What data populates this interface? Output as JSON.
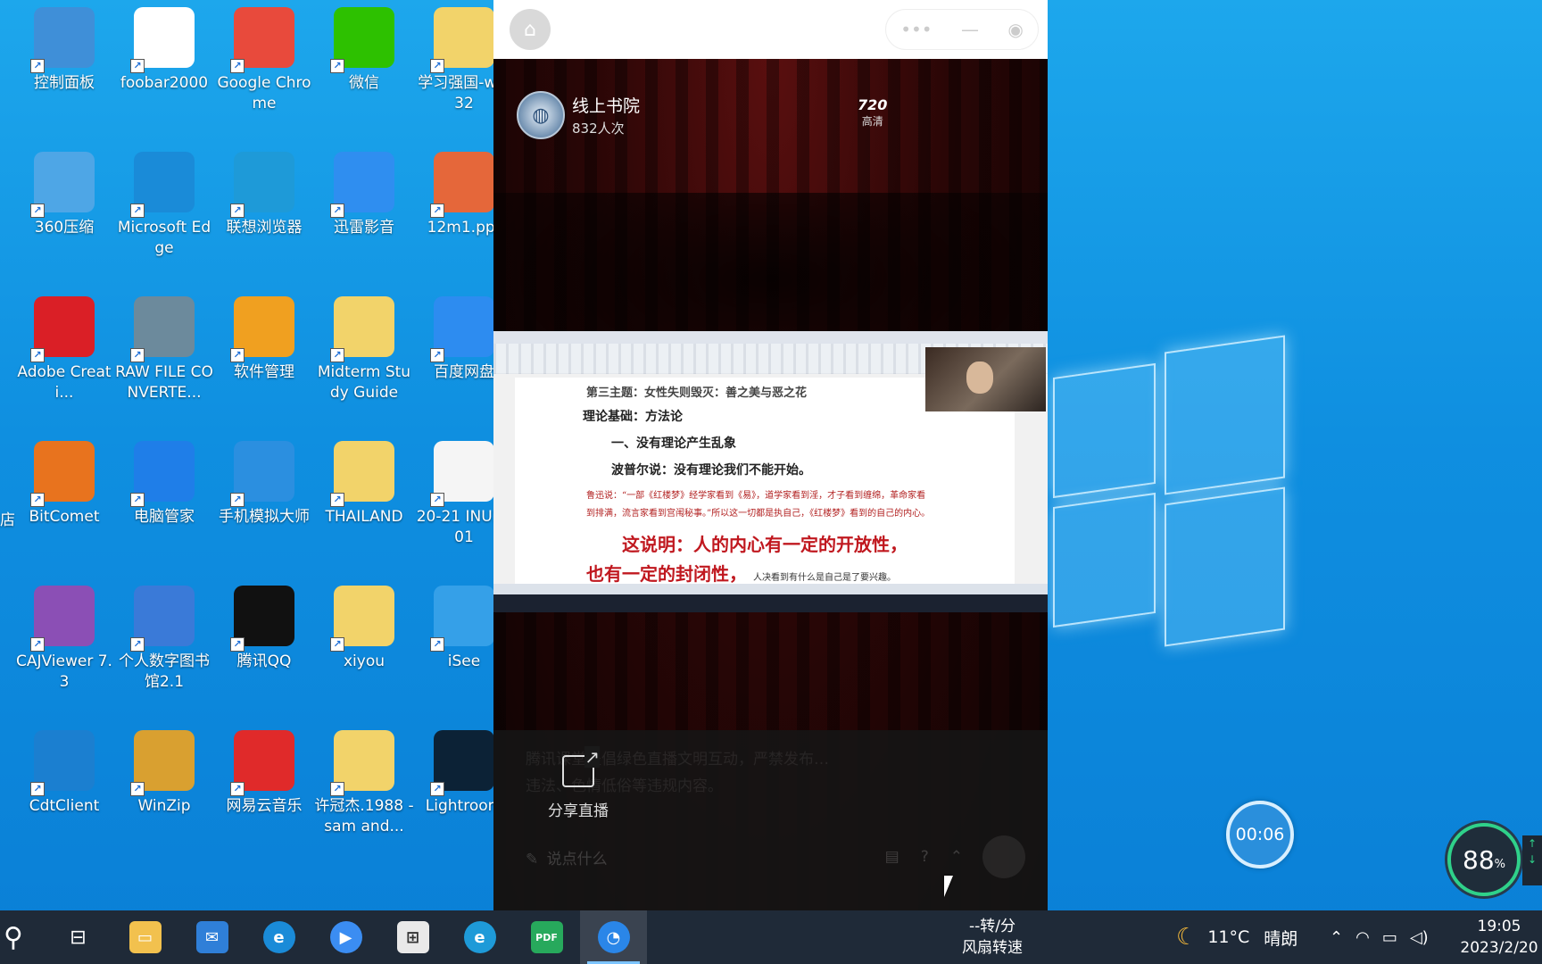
{
  "desktop_icons": [
    {
      "label": "控制面板",
      "icon": "control-panel-icon",
      "color": "#3f8fd8"
    },
    {
      "label": "foobar2000",
      "icon": "foobar-icon",
      "color": "#ffffff"
    },
    {
      "label": "Google Chrome",
      "icon": "chrome-icon",
      "color": "#e84a3c"
    },
    {
      "label": "微信",
      "icon": "wechat-icon",
      "color": "#2dc100"
    },
    {
      "label": "学习强国-win32",
      "icon": "folder-icon",
      "color": "#f2d36a"
    },
    {
      "label": "360压缩",
      "icon": "zip-360-icon",
      "color": "#4ea6e6"
    },
    {
      "label": "Microsoft Edge",
      "icon": "edge-icon",
      "color": "#1a8bd8"
    },
    {
      "label": "联想浏览器",
      "icon": "lenovo-browser-icon",
      "color": "#1e9ad8"
    },
    {
      "label": "迅雷影音",
      "icon": "xunlei-player-icon",
      "color": "#2f8ef0"
    },
    {
      "label": "12m1.ppt",
      "icon": "ppt-file-icon",
      "color": "#e5673a"
    },
    {
      "label": "Adobe Creati...",
      "icon": "adobe-cc-icon",
      "color": "#da1f26"
    },
    {
      "label": "RAW FILE CONVERTE...",
      "icon": "raw-converter-icon",
      "color": "#6c8a9c"
    },
    {
      "label": "软件管理",
      "icon": "software-manager-icon",
      "color": "#f0a020"
    },
    {
      "label": "Midterm Study Guide",
      "icon": "folder-icon",
      "color": "#f2d36a"
    },
    {
      "label": "百度网盘",
      "icon": "baidu-netdisk-icon",
      "color": "#2d8cf0"
    },
    {
      "label": "BitComet",
      "icon": "bitcomet-icon",
      "color": "#e8731e"
    },
    {
      "label": "电脑管家",
      "icon": "pc-manager-icon",
      "color": "#1f7ee8"
    },
    {
      "label": "手机模拟大师",
      "icon": "phone-emulator-icon",
      "color": "#2b8fe0"
    },
    {
      "label": "THAILAND",
      "icon": "folder-icon",
      "color": "#f2d36a"
    },
    {
      "label": "20-21 INU1101",
      "icon": "file-icon",
      "color": "#f5f5f5"
    },
    {
      "label": "CAJViewer 7.3",
      "icon": "cajviewer-icon",
      "color": "#8b4fb5"
    },
    {
      "label": "个人数字图书馆2.1",
      "icon": "digital-library-icon",
      "color": "#3a7ad8"
    },
    {
      "label": "腾讯QQ",
      "icon": "qq-icon",
      "color": "#111111"
    },
    {
      "label": "xiyou",
      "icon": "folder-icon",
      "color": "#f2d36a"
    },
    {
      "label": "iSee",
      "icon": "isee-icon",
      "color": "#35a0e8"
    },
    {
      "label": "CdtClient",
      "icon": "cdtclient-icon",
      "color": "#1b7fd0"
    },
    {
      "label": "WinZip",
      "icon": "winzip-icon",
      "color": "#d9a030"
    },
    {
      "label": "网易云音乐",
      "icon": "netease-music-icon",
      "color": "#e02a2a"
    },
    {
      "label": "许冠杰.1988 - sam and...",
      "icon": "folder-icon",
      "color": "#f2d36a"
    },
    {
      "label": "Lightroom",
      "icon": "lightroom-icon",
      "color": "#0c2236"
    }
  ],
  "desktop_left_cut_label": "店",
  "live_window": {
    "channel_name": "线上书院",
    "viewers": "832人次",
    "quality_value": "720",
    "quality_label": "高清",
    "share_label": "分享直播",
    "notice_ghost": "腾讯课堂提倡绿色直播文明互动，严禁发布…违法、色情低俗等违规内容。",
    "comment_ghost": "说点什么",
    "video_doc": {
      "line1": "第三主题：女性失则毁灭：善之美与恶之花",
      "line2": "理论基础：方法论",
      "line3": "一、没有理论产生乱象",
      "line4": "波普尔说：没有理论我们不能开始。",
      "small": "鲁迅说：“一部《红楼梦》经学家看到《易》，道学家看到淫，才子看到缠绵，革命家看到排满，流言家看到宫闱秘事。”所以这一切都是执自己，《红楼梦》看到的自己的内心。",
      "big1": "这说明：人的内心有一定的开放性，",
      "big2": "也有一定的封闭性，",
      "big2_tail": "人决看到有什么是自己是了要兴趣。"
    }
  },
  "recording_timer": "00:06",
  "gauge": {
    "value": "88",
    "unit": "%"
  },
  "taskbar": {
    "fan_line1": "--转/分",
    "fan_line2": "风扇转速",
    "temperature": "11°C",
    "weather": "晴朗",
    "time": "19:05",
    "date": "2023/2/20"
  },
  "colors": {
    "desktop_blue": "#1da7ec",
    "taskbar": "#1f2a38",
    "accent_red": "#c0181f"
  }
}
